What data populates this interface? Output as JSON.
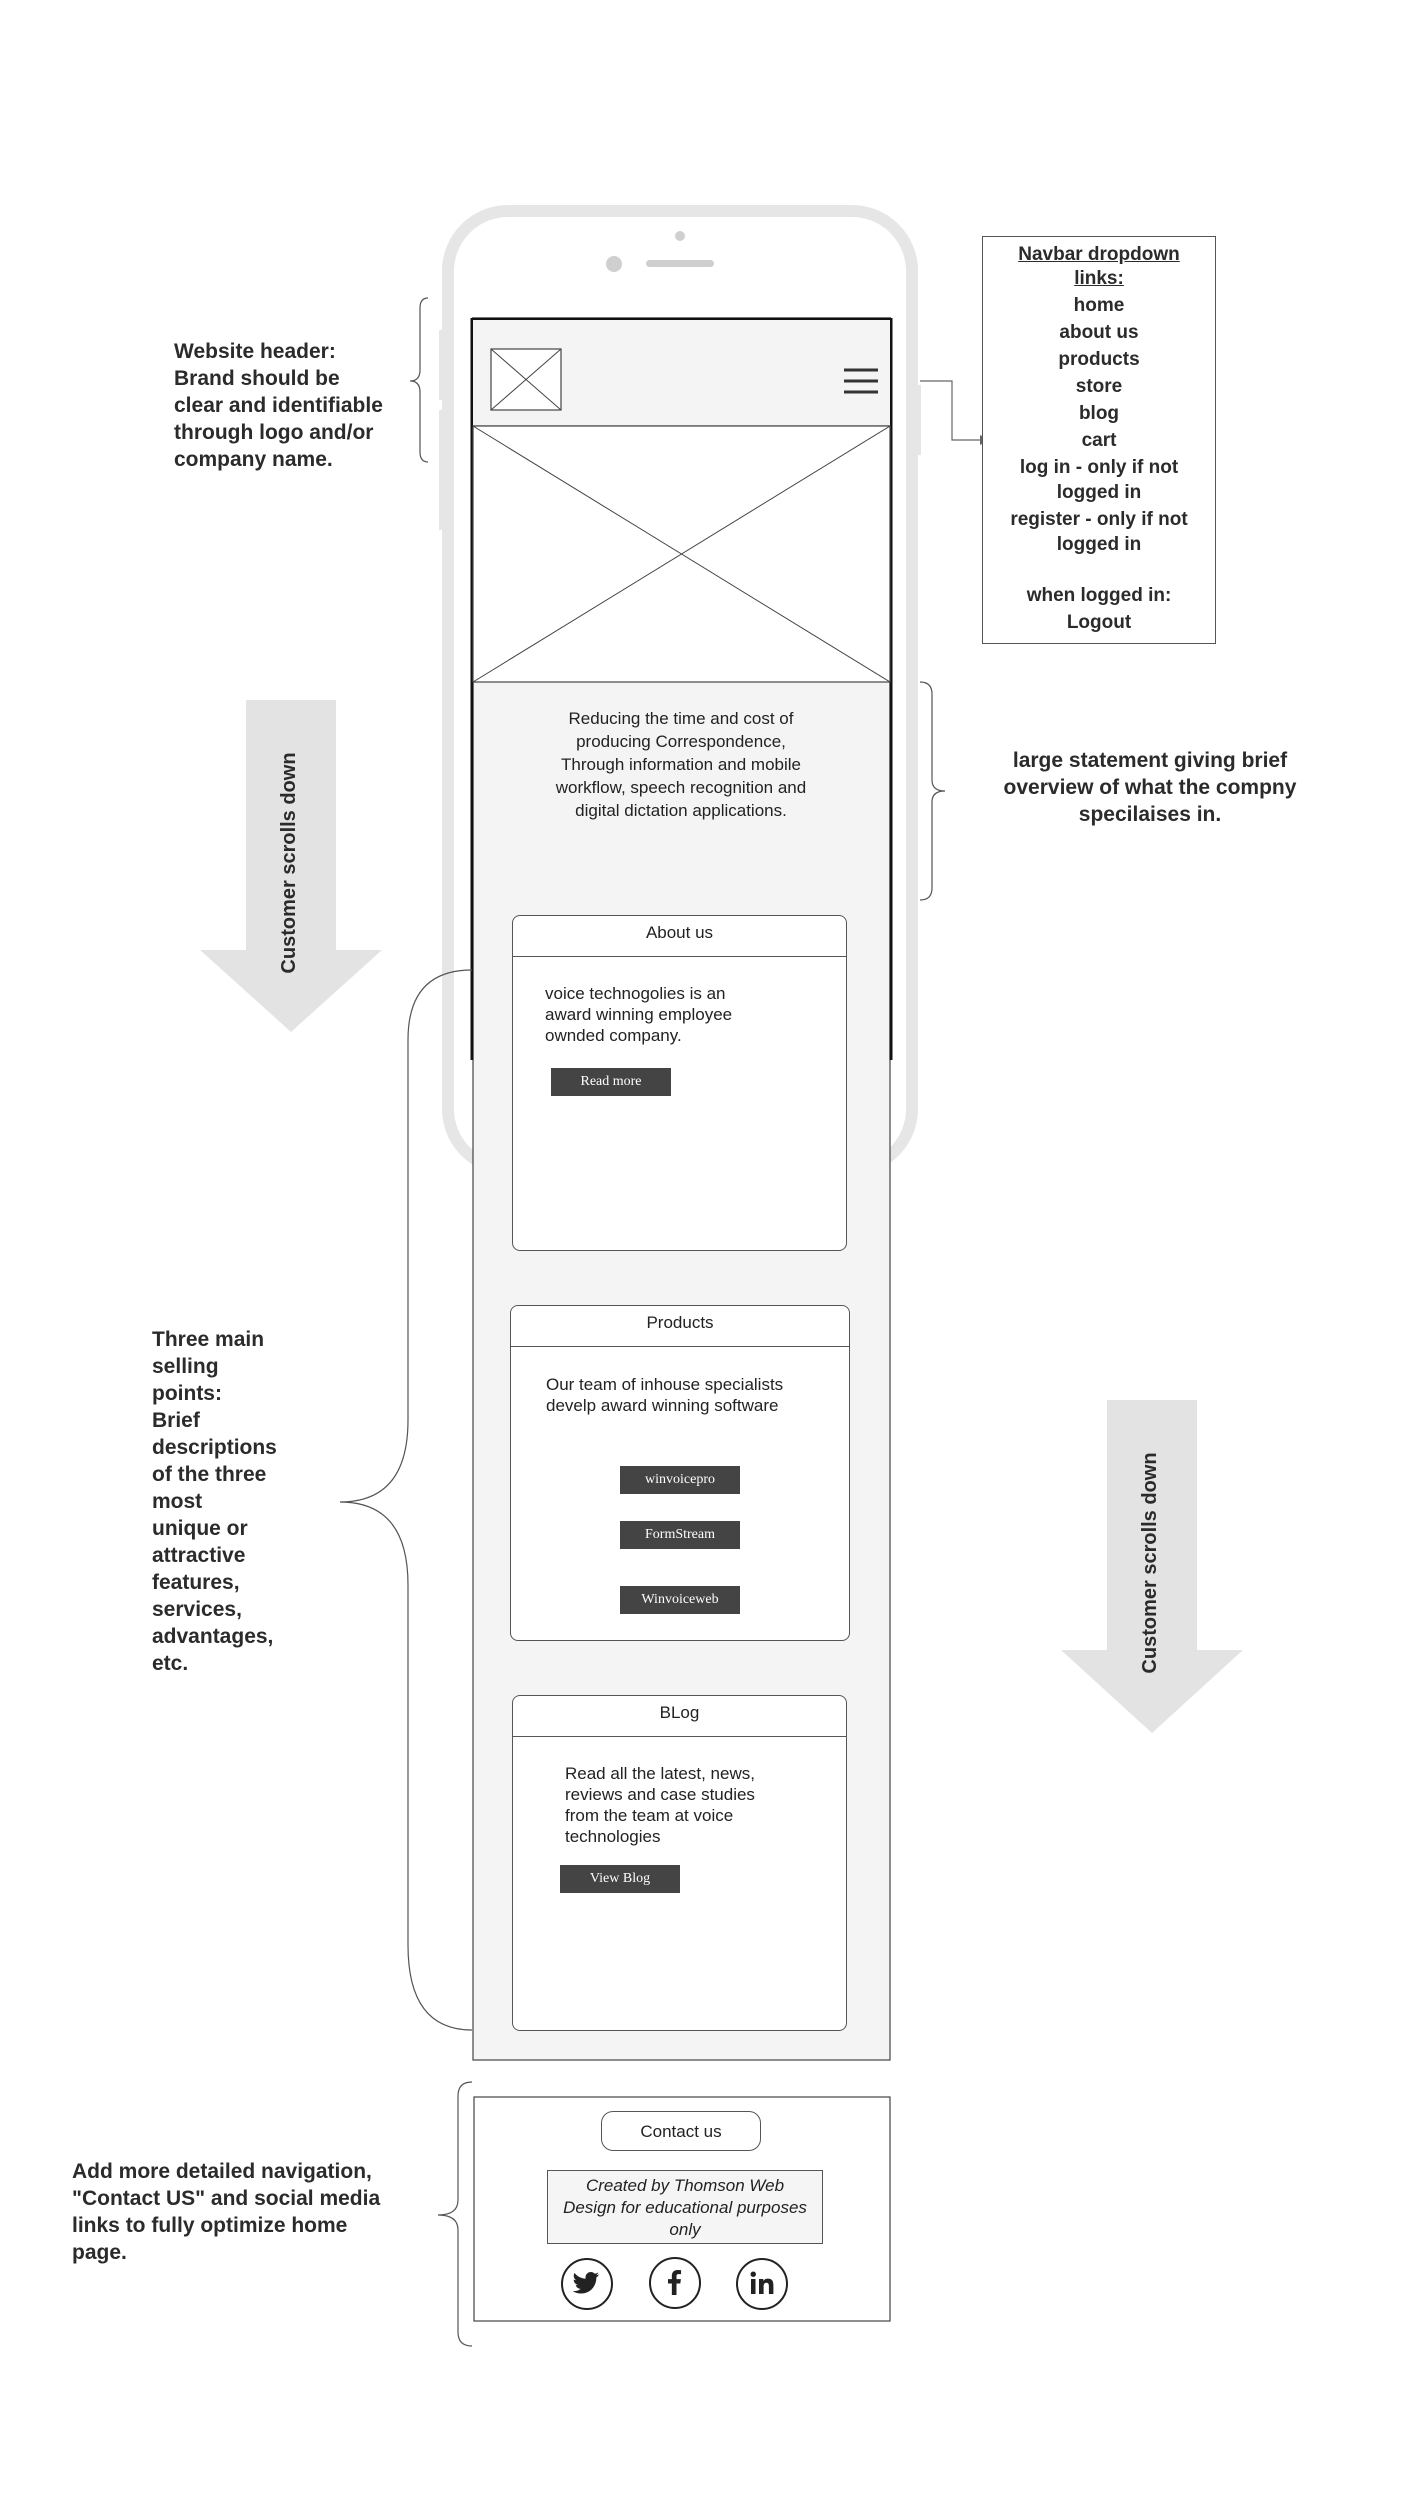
{
  "annotations": {
    "header_note": "Website header:\nBrand should be\nclear and identifiable\nthrough logo and/or\ncompany name.",
    "statement_note": "large statement giving brief\noverview of what the compny\nspecilaises in.",
    "selling_note": "Three main\nselling\npoints:\nBrief\ndescriptions\nof the three\nmost\nunique or\nattractive\nfeatures,\nservices,\nadvantages,\netc.",
    "footer_note": "Add more detailed navigation,\n\"Contact US\" and social media\nlinks to fully optimize home\npage.",
    "scroll_label_left": "Customer scrolls down",
    "scroll_label_right": "Customer scrolls down"
  },
  "navbar_dropdown": {
    "title": "Navbar dropdown\nlinks:",
    "items": [
      "home",
      "about us",
      "products",
      "store",
      "blog",
      "cart",
      "log in - only if not\nlogged in",
      "register  - only if not\nlogged in",
      "",
      "when logged in:",
      "Logout"
    ]
  },
  "hero": {
    "statement": "Reducing the time and cost of\nproducing Correspondence,\nThrough information and mobile\nworkflow, speech recognition and\ndigital dictation applications."
  },
  "about_card": {
    "title": "About us",
    "text": "voice technogolies is an\naward winning employee\nownded company.",
    "button": "Read more"
  },
  "products_card": {
    "title": "Products",
    "text": "Our team of inhouse specialists\ndevelp award winning software",
    "buttons": [
      "winvoicepro",
      "FormStream",
      "Winvoiceweb"
    ]
  },
  "blog_card": {
    "title": "BLog",
    "text": "Read all the latest, news,\nreviews and case studies\nfrom the team at voice\ntechnologies",
    "button": "View Blog"
  },
  "footer": {
    "contact_button": "Contact us",
    "credit": "Created by Thomson Web\nDesign for educational purposes\nonly",
    "social_icons": [
      "twitter-icon",
      "facebook-icon",
      "linkedin-icon"
    ]
  },
  "colors": {
    "screen_bg": "#f4f4f4",
    "button_dark": "#444444",
    "arrow_gray": "#e3e3e3",
    "phone_frame": "#e6e6e6"
  }
}
